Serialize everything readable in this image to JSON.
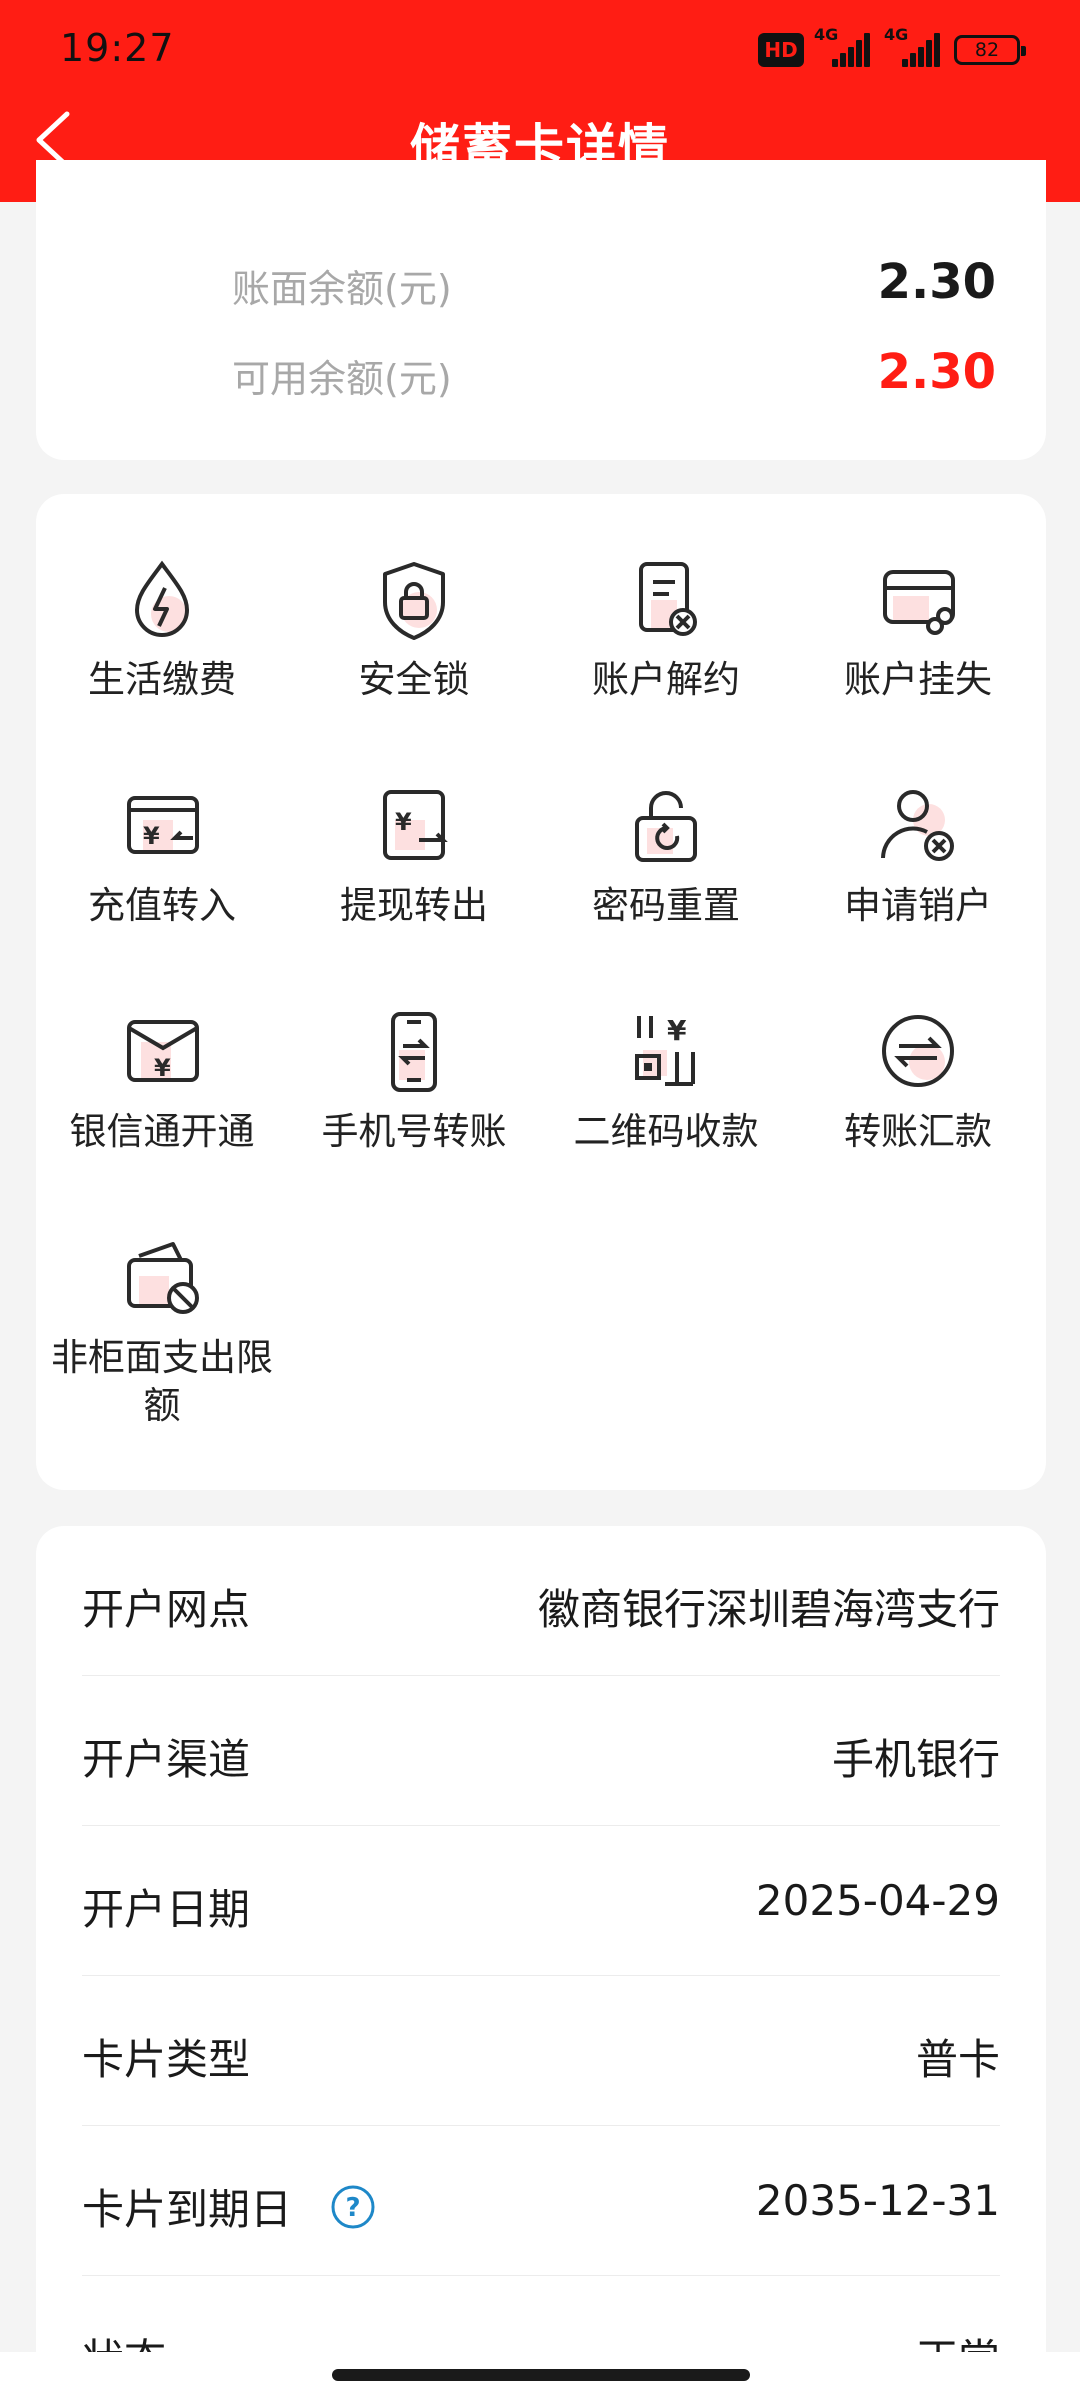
{
  "status_bar": {
    "time": "19:27",
    "hd_badge": "HD",
    "network1": "4G",
    "network2": "4G",
    "battery": "82"
  },
  "header": {
    "title": "储蓄卡详情",
    "back_icon": "chevron-left-icon",
    "background_color": "#ff1d14"
  },
  "balance": {
    "book_label": "账面余额(元)",
    "book_value": "2.30",
    "available_label": "可用余额(元)",
    "available_value": "2.30",
    "available_color": "#ff1d14"
  },
  "functions": [
    {
      "label": "生活缴费",
      "icon": "lightning-drop-icon"
    },
    {
      "label": "安全锁",
      "icon": "shield-lock-icon"
    },
    {
      "label": "账户解约",
      "icon": "document-cancel-icon"
    },
    {
      "label": "账户挂失",
      "icon": "card-link-icon"
    },
    {
      "label": "充值转入",
      "icon": "yuan-card-in-icon"
    },
    {
      "label": "提现转出",
      "icon": "yuan-card-out-icon"
    },
    {
      "label": "密码重置",
      "icon": "lock-refresh-icon"
    },
    {
      "label": "申请销户",
      "icon": "user-cancel-icon"
    },
    {
      "label": "银信通开通",
      "icon": "yuan-envelope-icon"
    },
    {
      "label": "手机号转账",
      "icon": "phone-transfer-icon"
    },
    {
      "label": "二维码收款",
      "icon": "qr-yuan-icon"
    },
    {
      "label": "转账汇款",
      "icon": "transfer-arrows-icon"
    },
    {
      "label": "非柜面支出限额",
      "icon": "wallet-limit-icon"
    }
  ],
  "account_info": [
    {
      "label": "开户网点",
      "value": "徽商银行深圳碧海湾支行"
    },
    {
      "label": "开户渠道",
      "value": "手机银行"
    },
    {
      "label": "开户日期",
      "value": "2025-04-29"
    },
    {
      "label": "卡片类型",
      "value": "普卡"
    },
    {
      "label": "卡片到期日",
      "value": "2035-12-31",
      "help_icon": "question-circle-icon"
    },
    {
      "label": "状态",
      "value": "正常"
    }
  ]
}
